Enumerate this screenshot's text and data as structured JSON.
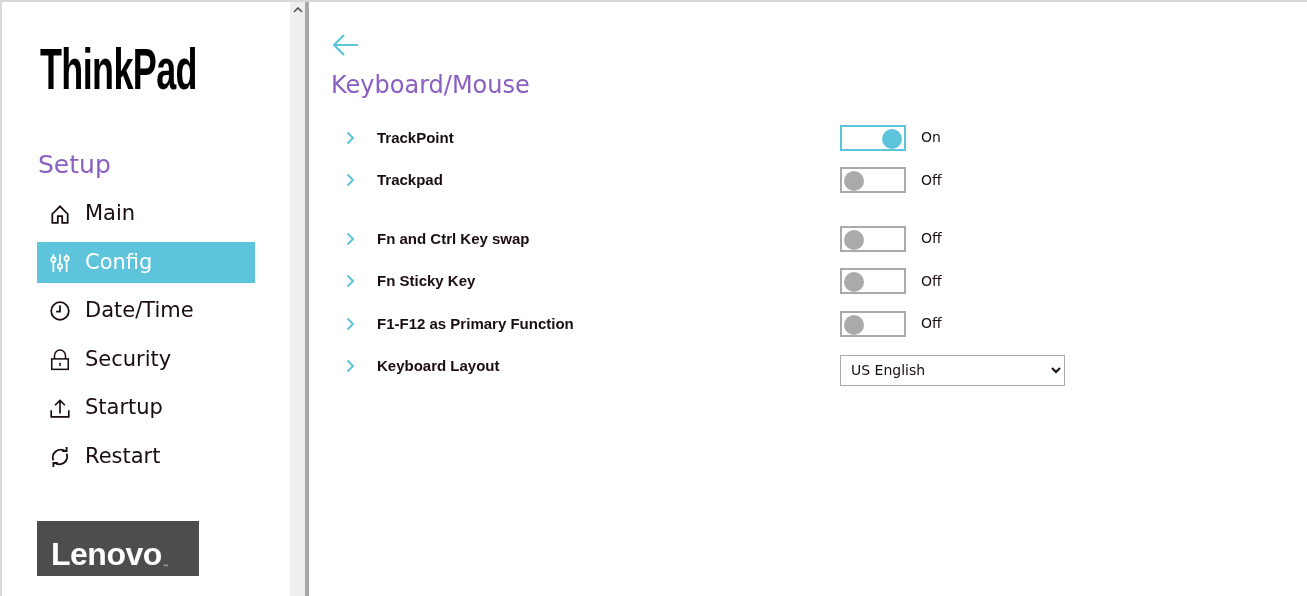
{
  "logo": {
    "text": "ThinkPad"
  },
  "sidebar": {
    "heading": "Setup",
    "items": [
      {
        "label": "Main",
        "selected": false
      },
      {
        "label": "Config",
        "selected": true
      },
      {
        "label": "Date/Time",
        "selected": false
      },
      {
        "label": "Security",
        "selected": false
      },
      {
        "label": "Startup",
        "selected": false
      },
      {
        "label": "Restart",
        "selected": false
      }
    ],
    "brand": {
      "text": "Lenovo",
      "mark": "™"
    }
  },
  "page": {
    "title": "Keyboard/Mouse",
    "groups": [
      {
        "settings": [
          {
            "kind": "toggle",
            "label": "TrackPoint",
            "on": true,
            "state_label": "On"
          },
          {
            "kind": "toggle",
            "label": "Trackpad",
            "on": false,
            "state_label": "Off"
          }
        ]
      },
      {
        "settings": [
          {
            "kind": "toggle",
            "label": "Fn and Ctrl Key swap",
            "on": false,
            "state_label": "Off"
          },
          {
            "kind": "toggle",
            "label": "Fn Sticky Key",
            "on": false,
            "state_label": "Off"
          },
          {
            "kind": "toggle",
            "label": "F1-F12 as Primary Function",
            "on": false,
            "state_label": "Off"
          },
          {
            "kind": "select",
            "label": "Keyboard Layout",
            "value": "US English"
          }
        ]
      }
    ]
  }
}
